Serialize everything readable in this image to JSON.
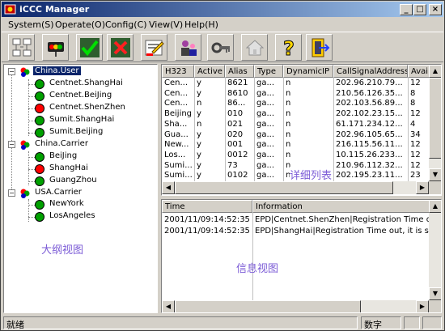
{
  "window": {
    "title": "iCCC Manager",
    "minimize": "_",
    "maximize": "□",
    "close": "×"
  },
  "menu": [
    {
      "label": "System(S)"
    },
    {
      "label": "Operate(O)"
    },
    {
      "label": "Config(C)"
    },
    {
      "label": "View(V)"
    },
    {
      "label": "Help(H)"
    }
  ],
  "toolbar": {
    "buttons": [
      {
        "icon": "network-icon"
      },
      {
        "icon": "traffic-light-icon"
      },
      {
        "icon": "checkmark-icon"
      },
      {
        "icon": "cross-icon"
      },
      {
        "icon": "edit-icon"
      },
      {
        "icon": "users-icon"
      },
      {
        "icon": "key-icon"
      },
      {
        "icon": "house-icon"
      },
      {
        "icon": "help-icon"
      },
      {
        "icon": "exit-icon"
      }
    ]
  },
  "tree": {
    "groups": [
      {
        "label": "China.User",
        "children": [
          {
            "label": "Centnet.ShangHai",
            "status": "green"
          },
          {
            "label": "Centnet.BeiJing",
            "status": "green"
          },
          {
            "label": "Centnet.ShenZhen",
            "status": "red"
          },
          {
            "label": "Sumit.ShangHai",
            "status": "green"
          },
          {
            "label": "Sumit.Beijing",
            "status": "green"
          }
        ]
      },
      {
        "label": "China.Carrier",
        "children": [
          {
            "label": "BeiJing",
            "status": "green"
          },
          {
            "label": "ShangHai",
            "status": "red"
          },
          {
            "label": "GuangZhou",
            "status": "green"
          }
        ]
      },
      {
        "label": "USA.Carrier",
        "children": [
          {
            "label": "NewYork",
            "status": "green"
          },
          {
            "label": "LosAngeles",
            "status": "green"
          }
        ]
      }
    ],
    "annotation": "大纲视图"
  },
  "grid": {
    "columns": [
      "H323",
      "Active",
      "Alias",
      "Type",
      "DynamicIP",
      "CallSignalAddress",
      "Available"
    ],
    "rows": [
      [
        "Cen...",
        "y",
        "8621",
        "ga...",
        "n",
        "202.96.210.79...",
        "12"
      ],
      [
        "Cen...",
        "y",
        "8610",
        "ga...",
        "n",
        "210.56.126.35...",
        "8"
      ],
      [
        "Cen...",
        "n",
        "86...",
        "ga...",
        "n",
        "202.103.56.89...",
        "8"
      ],
      [
        "Beijing",
        "y",
        "010",
        "ga...",
        "n",
        "202.102.23.15...",
        "12"
      ],
      [
        "Sha...",
        "n",
        "021",
        "ga...",
        "n",
        "61.171.234.12...",
        "4"
      ],
      [
        "Gua...",
        "y",
        "020",
        "ga...",
        "n",
        "202.96.105.65...",
        "34"
      ],
      [
        "New...",
        "y",
        "001",
        "ga...",
        "n",
        "216.115.56.11...",
        "12"
      ],
      [
        "Los...",
        "y",
        "0012",
        "ga...",
        "n",
        "10.115.26.233...",
        "12"
      ],
      [
        "Sumi...",
        "y",
        "73",
        "ga...",
        "n",
        "210.96.112.32...",
        "12"
      ],
      [
        "Sumi...",
        "y",
        "0102",
        "ga...",
        "n",
        "202.195.23.11...",
        "23"
      ]
    ],
    "annotation": "详细列表"
  },
  "info": {
    "columns": [
      "Time",
      "Information"
    ],
    "rows": [
      [
        "2001/11/09:14:52:35",
        "EPD|Centnet.ShenZhen|Registration Time out, it is s"
      ],
      [
        "2001/11/09:14:52:35",
        "EPD|ShangHai|Registration Time out, it is set to inac"
      ]
    ],
    "annotation": "信息视图"
  },
  "status": {
    "text": "就绪",
    "num": "数字"
  }
}
